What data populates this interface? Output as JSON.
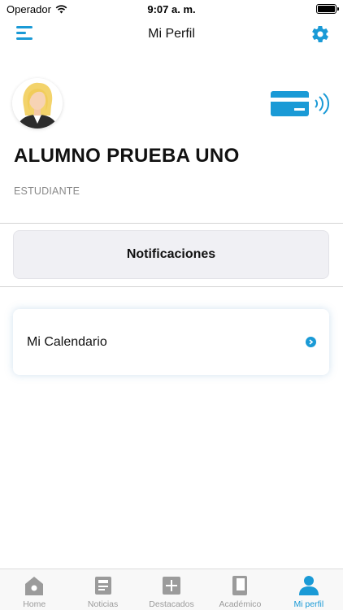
{
  "status_bar": {
    "carrier": "Operador",
    "time": "9:07 a. m.",
    "battery_level": 1.0
  },
  "nav": {
    "title": "Mi Perfil",
    "menu_icon": "hamburger-menu-icon",
    "settings_icon": "gear-icon"
  },
  "profile": {
    "avatar_icon": "user-avatar-icon",
    "card_icon": "contactless-card-icon",
    "name": "ALUMNO PRUEBA UNO",
    "role": "ESTUDIANTE"
  },
  "actions": {
    "notifications_label": "Notificaciones",
    "calendar_label": "Mi Calendario",
    "calendar_icon": "chevron-right-circle-icon"
  },
  "tabs": [
    {
      "label": "Home",
      "icon": "home-icon",
      "active": false
    },
    {
      "label": "Noticias",
      "icon": "news-icon",
      "active": false
    },
    {
      "label": "Destacados",
      "icon": "plus-square-icon",
      "active": false
    },
    {
      "label": "Académico",
      "icon": "book-icon",
      "active": false
    },
    {
      "label": "Mi perfil",
      "icon": "person-icon",
      "active": true
    }
  ],
  "colors": {
    "accent": "#1a9ad6",
    "tab_inactive": "#9b9b9b",
    "card_bg": "#f0f0f4"
  }
}
